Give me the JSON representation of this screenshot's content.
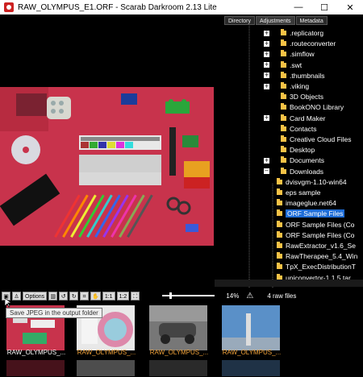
{
  "window": {
    "title": "RAW_OLYMPUS_E1.ORF - Scarab Darkroom 2.13 Lite",
    "minimize_glyph": "—",
    "maximize_glyph": "☐",
    "close_glyph": "✕",
    "icon": "app-logo-icon"
  },
  "panel": {
    "tabs": [
      {
        "label": "Directory",
        "active": false
      },
      {
        "label": "Adjustments",
        "active": true
      },
      {
        "label": "Metadata",
        "active": false
      }
    ],
    "tree": [
      {
        "label": ".replicatorg",
        "expand": "+",
        "indent": 0
      },
      {
        "label": ".routeconverter",
        "expand": "+",
        "indent": 0
      },
      {
        "label": ".simflow",
        "expand": "+",
        "indent": 0
      },
      {
        "label": ".swt",
        "expand": "+",
        "indent": 0
      },
      {
        "label": ".thumbnails",
        "expand": "+",
        "indent": 0
      },
      {
        "label": ".viking",
        "expand": "+",
        "indent": 0
      },
      {
        "label": "3D Objects",
        "expand": "",
        "indent": 0
      },
      {
        "label": "BookONO Library",
        "expand": "",
        "indent": 0
      },
      {
        "label": "Card Maker",
        "expand": "+",
        "indent": 0
      },
      {
        "label": "Contacts",
        "expand": "",
        "indent": 0
      },
      {
        "label": "Creative Cloud Files",
        "expand": "",
        "indent": 0
      },
      {
        "label": "Desktop",
        "expand": "",
        "indent": 0
      },
      {
        "label": "Documents",
        "expand": "+",
        "indent": 0
      },
      {
        "label": "Downloads",
        "expand": "−",
        "indent": 0
      },
      {
        "label": "dvisvgm-1.10-win64",
        "expand": "",
        "indent": 1
      },
      {
        "label": "eps sample",
        "expand": "",
        "indent": 1
      },
      {
        "label": "imageglue.net64",
        "expand": "",
        "indent": 1
      },
      {
        "label": "ORF Sample Files",
        "expand": "",
        "indent": 1,
        "selected": true
      },
      {
        "label": "ORF Sample Files (Co",
        "expand": "",
        "indent": 1
      },
      {
        "label": "ORF Sample Files (Co",
        "expand": "",
        "indent": 1
      },
      {
        "label": "RawExtractor_v1.6_Se",
        "expand": "",
        "indent": 1
      },
      {
        "label": "RawTherapee_5.4_Win",
        "expand": "",
        "indent": 1
      },
      {
        "label": "TpX_ExecDistributionT",
        "expand": "+",
        "indent": 1
      },
      {
        "label": "uniconvertor-1.1.5.tar",
        "expand": "+",
        "indent": 1
      }
    ]
  },
  "toolbar": {
    "save_jpeg_icon": "save-jpeg-icon",
    "person_icon": "person-icon",
    "options_label": "Options",
    "delete_icon": "trash-icon",
    "rotate_left_icon": "rotate-left-icon",
    "rotate_right_icon": "rotate-right-icon",
    "crop_icon": "crop-icon",
    "hand_icon": "hand-icon",
    "zoom_1_1_label": "1:1",
    "zoom_1_2_label": "1:2",
    "fit_icon": "fit-icon",
    "zoom_percent": "14%",
    "zoom_level": 0.14,
    "warning_glyph": "⚠",
    "file_count": "4 raw files"
  },
  "tooltip": {
    "text": "Save JPEG in the output folder"
  },
  "thumbnails": [
    {
      "label": "RAW_OLYMPUS_...",
      "color": "#ffffff"
    },
    {
      "label": "RAW_OLYMPUS_...",
      "color": "#f2a33a"
    },
    {
      "label": "RAW_OLYMPUS_...",
      "color": "#f2a33a"
    },
    {
      "label": "RAW_OLYMPUS_...",
      "color": "#f2a33a"
    }
  ],
  "colors": {
    "selection": "#1e6dd8",
    "folder": "#f6c246",
    "background": "#000000"
  }
}
